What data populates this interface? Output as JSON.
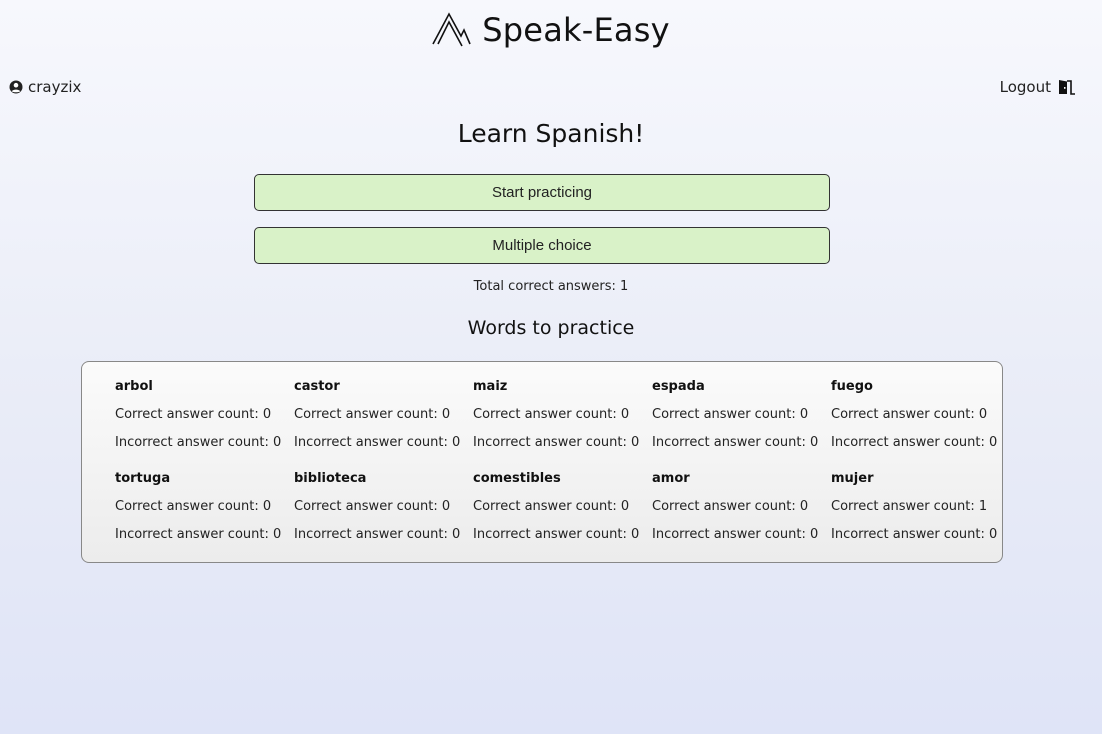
{
  "header": {
    "app_name": "Speak-Easy",
    "logo_icon": "mountain-logo-icon"
  },
  "user": {
    "icon": "user-circle-icon",
    "name": "crayzix"
  },
  "logout": {
    "label": "Logout",
    "icon": "door-exit-icon"
  },
  "main": {
    "title": "Learn Spanish!",
    "start_button": "Start practicing",
    "multiple_choice_button": "Multiple choice",
    "total_correct": "Total correct answers: 1",
    "words_title": "Words to practice"
  },
  "words": [
    {
      "word": "arbol",
      "correct": "Correct answer count: 0",
      "incorrect": "Incorrect answer count: 0"
    },
    {
      "word": "castor",
      "correct": "Correct answer count: 0",
      "incorrect": "Incorrect answer count: 0"
    },
    {
      "word": "maiz",
      "correct": "Correct answer count: 0",
      "incorrect": "Incorrect answer count: 0"
    },
    {
      "word": "espada",
      "correct": "Correct answer count: 0",
      "incorrect": "Incorrect answer count: 0"
    },
    {
      "word": "fuego",
      "correct": "Correct answer count: 0",
      "incorrect": "Incorrect answer count: 0"
    },
    {
      "word": "tortuga",
      "correct": "Correct answer count: 0",
      "incorrect": "Incorrect answer count: 0"
    },
    {
      "word": "biblioteca",
      "correct": "Correct answer count: 0",
      "incorrect": "Incorrect answer count: 0"
    },
    {
      "word": "comestibles",
      "correct": "Correct answer count: 0",
      "incorrect": "Incorrect answer count: 0"
    },
    {
      "word": "amor",
      "correct": "Correct answer count: 0",
      "incorrect": "Incorrect answer count: 0"
    },
    {
      "word": "mujer",
      "correct": "Correct answer count: 1",
      "incorrect": "Incorrect answer count: 0"
    }
  ],
  "colors": {
    "button_bg": "#d9f2c8",
    "panel_border": "#888888"
  }
}
